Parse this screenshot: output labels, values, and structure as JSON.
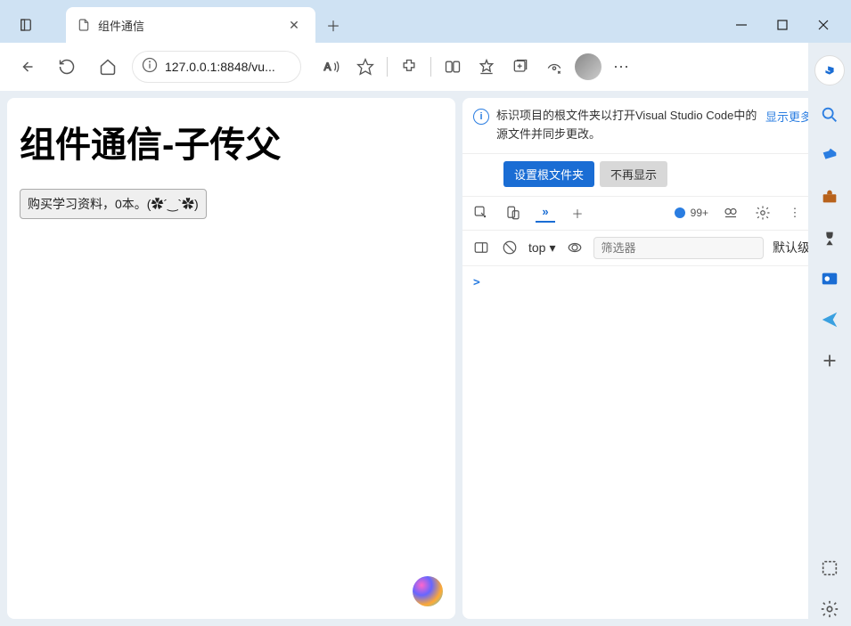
{
  "window": {
    "tab_title": "组件通信",
    "minimize": "−",
    "maximize": "□",
    "close": "✕"
  },
  "toolbar": {
    "url": "127.0.0.1:8848/vu..."
  },
  "page": {
    "heading": "组件通信-子传父",
    "button_label": "购买学习资料，0本。(✿´‿`✿)"
  },
  "devtools": {
    "info_icon": "i",
    "notice_text": "标识项目的根文件夹以打开Visual Studio Code中的源文件并同步更改。",
    "show_more": "显示更多",
    "btn_primary": "设置根文件夹",
    "btn_secondary": "不再显示",
    "issues_count": "99+",
    "filter": {
      "top": "top",
      "placeholder": "筛选器",
      "default_level": "默认级"
    },
    "console_prompt": ">"
  }
}
